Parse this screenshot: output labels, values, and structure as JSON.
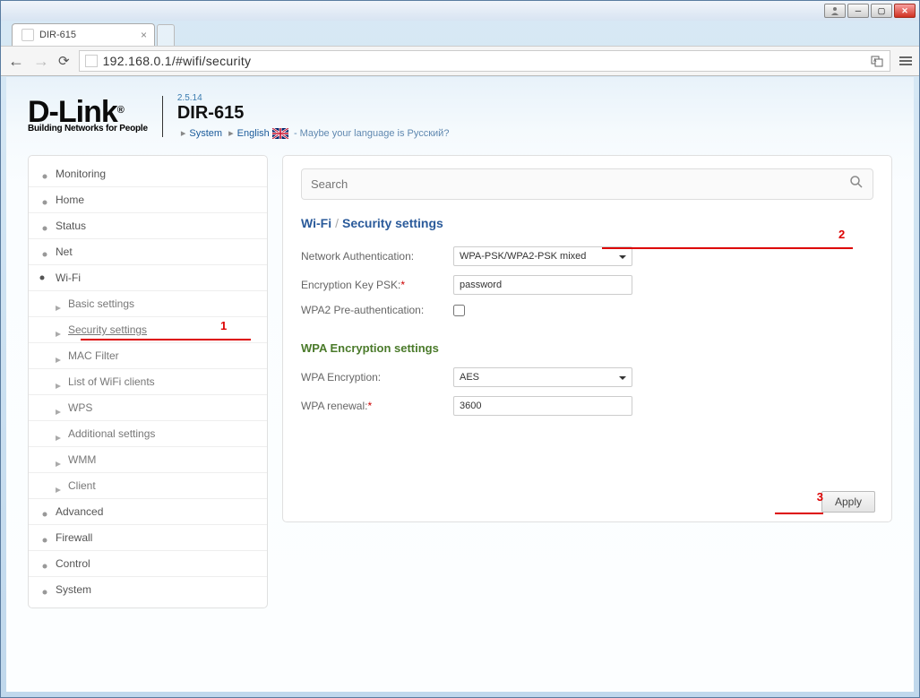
{
  "browser": {
    "tab_title": "DIR-615",
    "url": "192.168.0.1/#wifi/security"
  },
  "header": {
    "brand": "D-Link",
    "tagline": "Building Networks for People",
    "version": "2.5.14",
    "model": "DIR-615",
    "crumb_system": "System",
    "crumb_lang": "English",
    "lang_prompt": "- Maybe your language is Русский?"
  },
  "search": {
    "placeholder": "Search"
  },
  "sidebar": {
    "items": [
      {
        "label": "Monitoring"
      },
      {
        "label": "Home"
      },
      {
        "label": "Status"
      },
      {
        "label": "Net"
      },
      {
        "label": "Wi-Fi"
      },
      {
        "label": "Advanced"
      },
      {
        "label": "Firewall"
      },
      {
        "label": "Control"
      },
      {
        "label": "System"
      }
    ],
    "wifi_sub": [
      {
        "label": "Basic settings"
      },
      {
        "label": "Security settings"
      },
      {
        "label": "MAC Filter"
      },
      {
        "label": "List of WiFi clients"
      },
      {
        "label": "WPS"
      },
      {
        "label": "Additional settings"
      },
      {
        "label": "WMM"
      },
      {
        "label": "Client"
      }
    ]
  },
  "content": {
    "title_parent": "Wi-Fi",
    "title_current": "Security settings",
    "fields": {
      "net_auth_label": "Network Authentication:",
      "net_auth_value": "WPA-PSK/WPA2-PSK mixed",
      "enc_key_label": "Encryption Key PSK:",
      "enc_key_value": "password",
      "preauth_label": "WPA2 Pre-authentication:",
      "wpa_section": "WPA Encryption settings",
      "wpa_enc_label": "WPA Encryption:",
      "wpa_enc_value": "AES",
      "wpa_renewal_label": "WPA renewal:",
      "wpa_renewal_value": "3600"
    },
    "apply_label": "Apply"
  },
  "annotations": {
    "n1": "1",
    "n2": "2",
    "n3": "3"
  }
}
